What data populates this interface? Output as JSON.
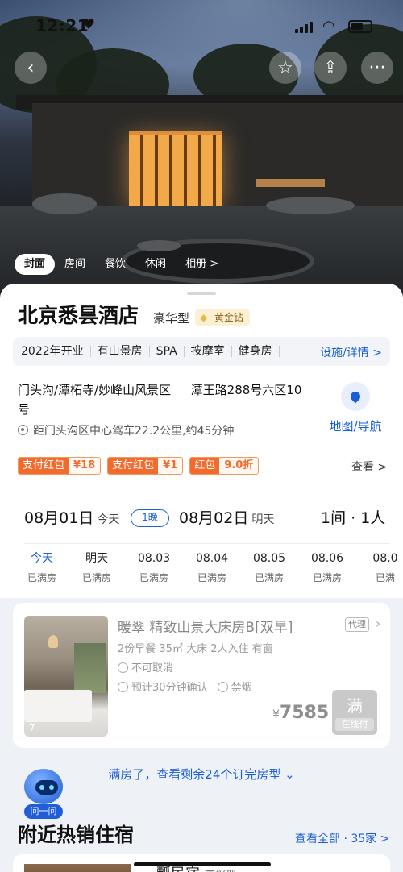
{
  "status_bar": {
    "time": "12:21"
  },
  "photo_tabs": [
    {
      "label": "封面"
    },
    {
      "label": "房间"
    },
    {
      "label": "餐饮"
    },
    {
      "label": "休闲"
    },
    {
      "label": "相册 >"
    }
  ],
  "hotel": {
    "name": "北京悉昙酒店",
    "class": "豪华型",
    "member_badge": "黄金钻"
  },
  "facilities": {
    "items": [
      "2022年开业",
      "有山景房",
      "SPA",
      "按摩室",
      "健身房"
    ],
    "more_label": "设施/详情 >"
  },
  "location": {
    "address": "门头沟/潭柘寺/妙峰山风景区 ｜ 潭王路288号六区10号",
    "distance": "距门头沟区中心驾车22.2公里,约45分钟",
    "map_label": "地图/导航"
  },
  "coupons": [
    {
      "tag": "支付红包",
      "value": "¥18"
    },
    {
      "tag": "支付红包",
      "value": "¥1"
    },
    {
      "tag": "红包",
      "value": "9.0折"
    }
  ],
  "coupons_more": "查看 >",
  "booking": {
    "check_in": "08月01日",
    "check_in_label": "今天",
    "nights": "1晚",
    "check_out": "08月02日",
    "check_out_label": "明天",
    "rooms_guests": "1间 · 1人",
    "days": [
      {
        "label": "今天",
        "status": "已满房"
      },
      {
        "label": "明天",
        "status": "已满房"
      },
      {
        "label": "08.03",
        "status": "已满房"
      },
      {
        "label": "08.04",
        "status": "已满房"
      },
      {
        "label": "08.05",
        "status": "已满房"
      },
      {
        "label": "08.06",
        "status": "已满房"
      },
      {
        "label": "08.0",
        "status": "已满"
      }
    ]
  },
  "room": {
    "photo_count": "7",
    "title": "暖翠 精致山景大床房B[双早]",
    "tag": "代理",
    "specs": "2份早餐  35㎡  大床  2人入住  有窗",
    "policy": "不可取消",
    "confirm": "预计30分钟确认",
    "smoking": "禁烟",
    "price_currency": "¥",
    "price": "7585",
    "status_big": "满",
    "status_small": "在线付"
  },
  "more_rooms": "满房了，查看剩余24个订完房型 ⌄",
  "assistant_label": "问一问",
  "nearby": {
    "title": "附近热销住宿",
    "view_all": "查看全部 · 35家 >",
    "peek_name": "一瓢民宿",
    "peek_class": "高档型"
  },
  "colors": {
    "accent": "#1b5fd8",
    "coupon": "#f26b2c",
    "badge": "#e5b84a"
  }
}
